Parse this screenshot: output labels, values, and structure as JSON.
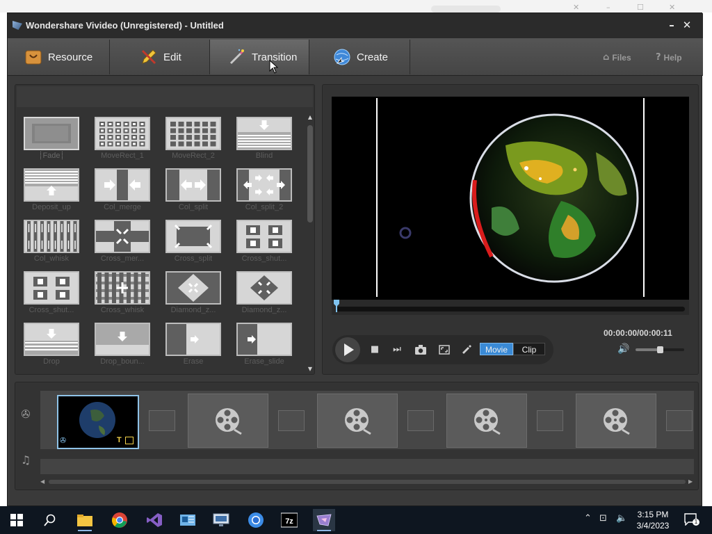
{
  "window": {
    "title": "Wondershare Vivideo (Unregistered) - Untitled",
    "minimize_glyph": "–",
    "close_glyph": "✕"
  },
  "tabs": [
    {
      "label": "Resource",
      "icon": "resource-icon"
    },
    {
      "label": "Edit",
      "icon": "pencil-icon"
    },
    {
      "label": "Transition",
      "icon": "magic-wand-icon",
      "active": true
    },
    {
      "label": "Create",
      "icon": "globe-create-icon"
    }
  ],
  "top_links": {
    "files": "Files",
    "help": "Help"
  },
  "transitions": [
    {
      "label": "Fade",
      "pattern": "fade"
    },
    {
      "label": "MoveRect_1",
      "pattern": "rect-grid"
    },
    {
      "label": "MoveRect_2",
      "pattern": "rect-grid-2"
    },
    {
      "label": "Blind",
      "pattern": "blind"
    },
    {
      "label": "Deposit_up",
      "pattern": "deposit-up"
    },
    {
      "label": "Col_merge",
      "pattern": "col-merge"
    },
    {
      "label": "Col_split",
      "pattern": "col-split"
    },
    {
      "label": "Col_split_2",
      "pattern": "col-split-2"
    },
    {
      "label": "Col_whisk",
      "pattern": "col-whisk"
    },
    {
      "label": "Cross_mer...",
      "pattern": "cross-merge"
    },
    {
      "label": "Cross_split",
      "pattern": "cross-split"
    },
    {
      "label": "Cross_shut...",
      "pattern": "cross-shutter"
    },
    {
      "label": "Cross_shut...",
      "pattern": "cross-shutter-2"
    },
    {
      "label": "Cross_whisk",
      "pattern": "cross-whisk"
    },
    {
      "label": "Diamond_z...",
      "pattern": "diamond-zoom"
    },
    {
      "label": "Diamond_z...",
      "pattern": "diamond-zoom-2"
    },
    {
      "label": "Drop",
      "pattern": "drop"
    },
    {
      "label": "Drop_boun...",
      "pattern": "drop-bounce"
    },
    {
      "label": "Erase",
      "pattern": "erase"
    },
    {
      "label": "Erase_slide",
      "pattern": "erase-slide"
    }
  ],
  "preview": {
    "timecode": "00:00:00/00:00:11",
    "mode_movie": "Movie",
    "mode_clip": "Clip",
    "playhead": 0,
    "volume": 0.5
  },
  "timeline": {
    "first_clip_badge_t": "T",
    "placeholder_count": 4
  },
  "taskbar": {
    "clock_time": "3:15 PM",
    "clock_date": "3/4/2023",
    "notification_count": "1",
    "apps": [
      "windows-start-icon",
      "search-icon",
      "file-explorer-icon",
      "chrome-icon",
      "visual-studio-icon",
      "outlook-icon",
      "remote-desktop-icon",
      "chrome-alt-icon",
      "7zip-icon",
      "vivideo-icon"
    ]
  },
  "colors": {
    "accent": "#3a8ad6",
    "panel": "#333333",
    "frame": "#3a3a3a"
  }
}
